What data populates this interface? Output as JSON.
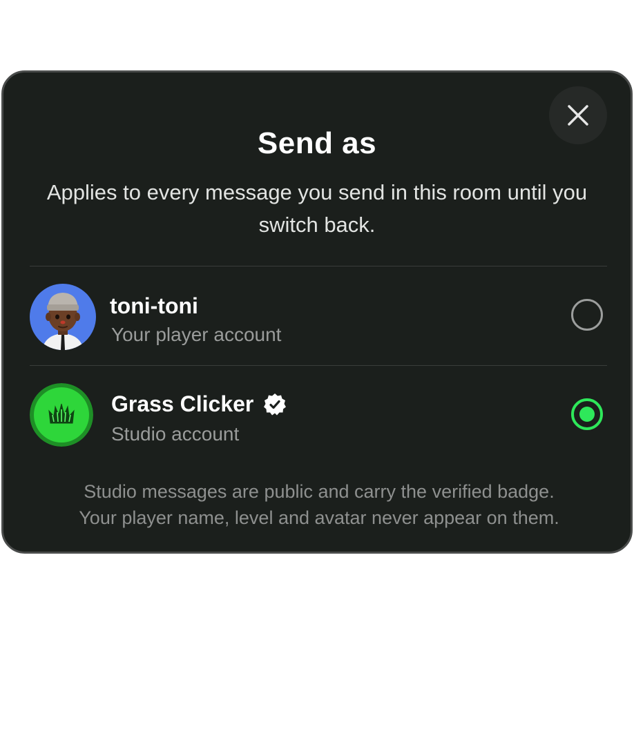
{
  "dialog": {
    "title": "Send as",
    "subtitle": "Applies to every message you send in this room until you switch back.",
    "close_icon": "close-icon",
    "footnote_line1": "Studio messages are public and carry the verified badge.",
    "footnote_line2": "Your player name, level and avatar never appear on them."
  },
  "options": [
    {
      "name": "toni-toni",
      "description": "Your player account",
      "avatar": "player-avatar",
      "selected": false
    },
    {
      "name": "Grass Clicker",
      "description": "Studio account",
      "avatar": "grass-logo-icon",
      "verified_icon": "verified-badge-icon",
      "selected": true
    }
  ],
  "colors": {
    "background": "#1b1f1c",
    "accent_green": "#2ee85a",
    "avatar_blue": "#4f7bea"
  }
}
